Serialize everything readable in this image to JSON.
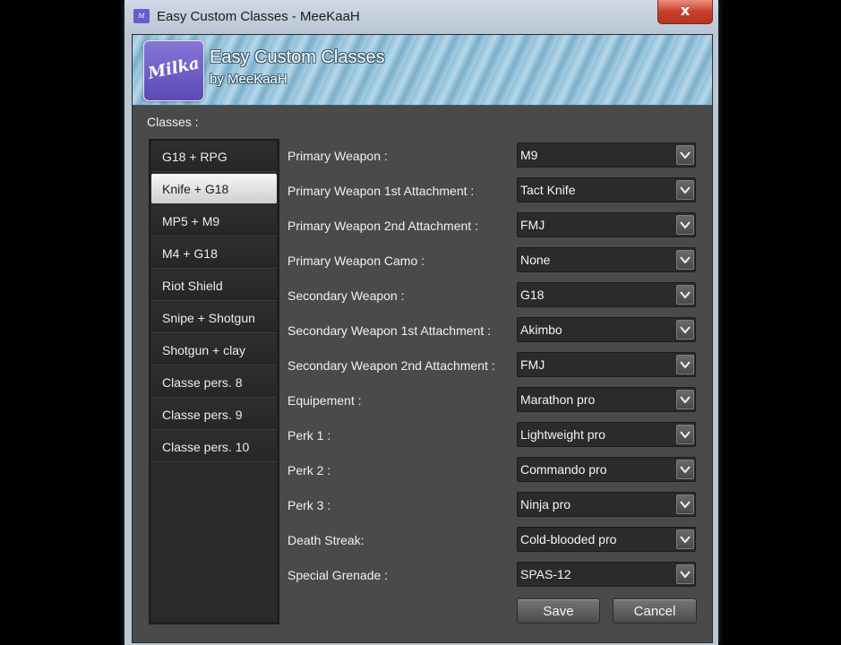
{
  "window": {
    "title": "Easy Custom Classes - MeeKaaH",
    "close_glyph": "x"
  },
  "header": {
    "logo_text": "Milka",
    "title": "Easy Custom Classes",
    "subtitle": "by MeeKaaH"
  },
  "classes": {
    "label": "Classes :",
    "items": [
      {
        "label": "G18 + RPG"
      },
      {
        "label": "Knife + G18"
      },
      {
        "label": "MP5 + M9"
      },
      {
        "label": "M4 + G18"
      },
      {
        "label": "Riot Shield"
      },
      {
        "label": "Snipe + Shotgun"
      },
      {
        "label": "Shotgun + clay"
      },
      {
        "label": "Classe pers. 8"
      },
      {
        "label": "Classe pers. 9"
      },
      {
        "label": "Classe pers. 10"
      }
    ],
    "selected": "Knife + G18"
  },
  "form": {
    "fields": [
      {
        "label": "Primary Weapon :",
        "value": "M9"
      },
      {
        "label": "Primary Weapon 1st Attachment :",
        "value": "Tact Knife"
      },
      {
        "label": "Primary Weapon 2nd Attachment :",
        "value": "FMJ"
      },
      {
        "label": "Primary Weapon Camo :",
        "value": "None"
      },
      {
        "label": "Secondary Weapon :",
        "value": "G18"
      },
      {
        "label": "Secondary Weapon 1st Attachment :",
        "value": "Akimbo"
      },
      {
        "label": "Secondary Weapon 2nd Attachment :",
        "value": "FMJ"
      },
      {
        "label": "Equipement :",
        "value": "Marathon pro"
      },
      {
        "label": "Perk 1 :",
        "value": "Lightweight pro"
      },
      {
        "label": "Perk 2 :",
        "value": "Commando pro"
      },
      {
        "label": "Perk 3 :",
        "value": "Ninja pro"
      },
      {
        "label": "Death Streak:",
        "value": "Cold-blooded pro"
      },
      {
        "label": "Special Grenade :",
        "value": "SPAS-12"
      }
    ]
  },
  "buttons": {
    "save": "Save",
    "cancel": "Cancel"
  },
  "colors": {
    "background": "#4a4a4a",
    "list_bg": "#2a2a2a",
    "header_accent": "#8fbfd8",
    "logo": "#6a5acd",
    "close": "#c8402c"
  }
}
